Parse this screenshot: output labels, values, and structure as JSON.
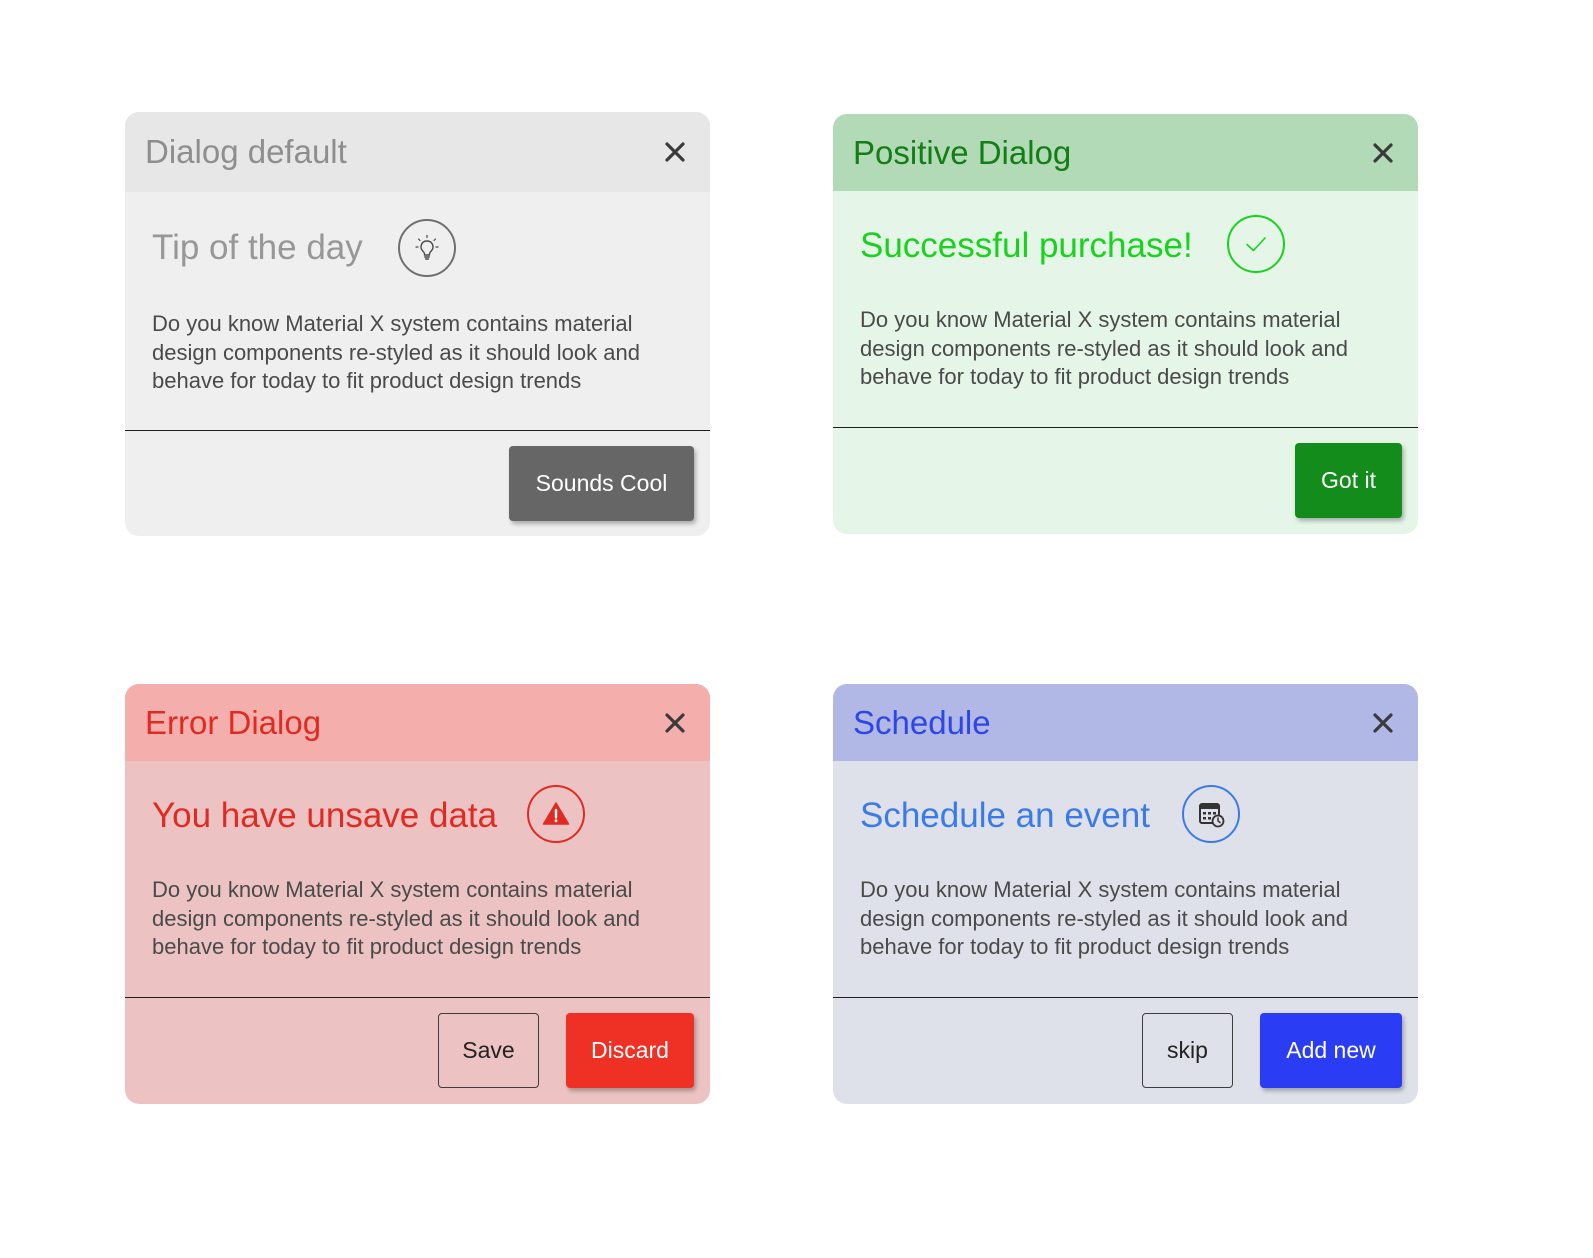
{
  "colors": {
    "default_header": "#e7e7e7",
    "positive_header": "#b2dab6",
    "error_header": "#f4aeab",
    "schedule_header": "#b1b8e6",
    "positive_accent": "#19d21d",
    "error_accent": "#e02b23",
    "schedule_accent": "#2c46e8"
  },
  "dialogs": {
    "default": {
      "header_title": "Dialog default",
      "content_title": "Tip of the day",
      "icon": "lightbulb-icon",
      "body": "Do you know Material X system contains material design components re-styled as it should look and behave for today to fit product design trends",
      "primary_label": "Sounds Cool"
    },
    "positive": {
      "header_title": "Positive Dialog",
      "content_title": "Successful purchase!",
      "icon": "checkmark-icon",
      "body": "Do you know Material X system contains material design components re-styled as it should look and behave for today to fit product design trends",
      "primary_label": "Got it"
    },
    "error": {
      "header_title": "Error Dialog",
      "content_title": "You have unsave data",
      "icon": "warning-icon",
      "body": "Do you know Material X system contains material design components re-styled as it should look and behave for today to fit product design trends",
      "secondary_label": "Save",
      "primary_label": "Discard"
    },
    "schedule": {
      "header_title": "Schedule",
      "content_title": "Schedule an event",
      "icon": "calendar-clock-icon",
      "body": "Do you know Material X system contains material design components re-styled as it should look and behave for today to fit product design trends",
      "secondary_label": "skip",
      "primary_label": "Add new"
    }
  }
}
